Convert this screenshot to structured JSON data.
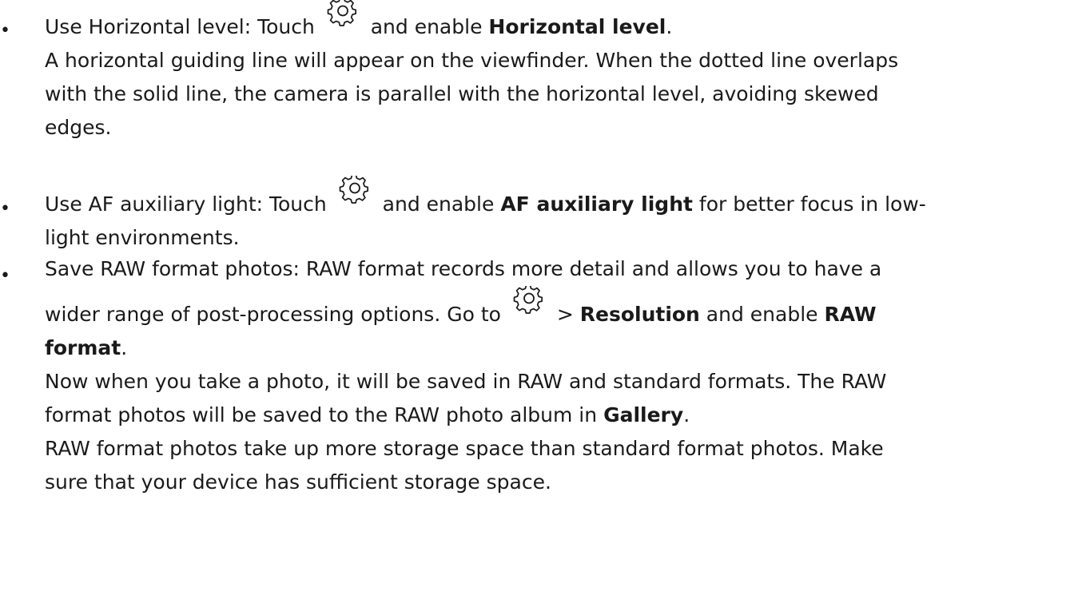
{
  "bullet_char": "•",
  "items": [
    {
      "p1_pre": "Use Horizontal level: Touch",
      "p1_mid": " and enable ",
      "p1_bold": "Horizontal level",
      "p1_post": ".",
      "lines": [
        "A horizontal guiding line will appear on the viewfinder. When the dotted line overlaps",
        "with the solid line, the camera is parallel with the horizontal level, avoiding skewed",
        "edges."
      ]
    },
    {
      "p1_pre": "Use AF auxiliary light: Touch",
      "p1_mid": " and enable ",
      "p1_bold": "AF auxiliary light",
      "p1_post": " for better focus in low-",
      "line2": "light environments."
    },
    {
      "line1": "Save RAW format photos: RAW format records more detail and allows you to have a",
      "line2_pre": "wider range of post-processing options. Go to",
      "line2_sep": " > ",
      "line2_bold1": "Resolution",
      "line2_mid": " and enable ",
      "line2_bold2": "RAW",
      "line3_bold": "format",
      "line3_post": ".",
      "p2_line1": "Now when you take a photo, it will be saved in RAW and standard formats. The RAW",
      "p2_line2_pre": "format photos will be saved to the RAW photo album in ",
      "p2_line2_bold": "Gallery",
      "p2_line2_post": ".",
      "p3_line1": "RAW format photos take up more storage space than standard format photos. Make",
      "p3_line2": "sure that your device has sufficient storage space."
    }
  ],
  "icons": {
    "settings": "gear-icon"
  }
}
